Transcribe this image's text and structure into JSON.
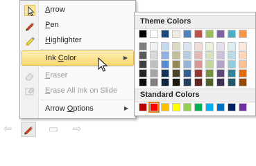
{
  "menu": {
    "items": [
      {
        "label": "Arrow",
        "hotkey": "A",
        "rest": "rrow",
        "icon": "arrow-pointer-icon",
        "checked": true,
        "disabled": false,
        "submenu": false
      },
      {
        "label": "Pen",
        "hotkey": "P",
        "rest": "en",
        "icon": "pen-icon",
        "checked": false,
        "disabled": false,
        "submenu": false
      },
      {
        "label": "Highlighter",
        "hotkey": "H",
        "rest": "ighlighter",
        "icon": "highlighter-icon",
        "checked": false,
        "disabled": false,
        "submenu": false
      },
      {
        "label": "Ink Color",
        "hotkey": "C",
        "pre": "Ink ",
        "rest": "olor",
        "icon": "",
        "checked": false,
        "disabled": false,
        "submenu": true,
        "highlighted": true
      },
      {
        "label": "Eraser",
        "hotkey": "E",
        "rest": "raser",
        "icon": "eraser-icon",
        "checked": false,
        "disabled": true,
        "submenu": false
      },
      {
        "label": "Erase All Ink on Slide",
        "hotkey": "E",
        "rest": "rase All Ink on Slide",
        "icon": "erase-all-icon",
        "checked": false,
        "disabled": true,
        "submenu": false
      },
      {
        "label": "Arrow Options",
        "hotkey": "O",
        "pre": "Arrow ",
        "rest": "ptions",
        "icon": "",
        "checked": false,
        "disabled": false,
        "submenu": true
      }
    ]
  },
  "palette": {
    "theme_title": "Theme Colors",
    "standard_title": "Standard Colors",
    "theme_top": [
      "#000000",
      "#ffffff",
      "#1f497d",
      "#eeece1",
      "#4f81bd",
      "#c0504d",
      "#9bbb59",
      "#8064a2",
      "#4bacc6",
      "#f79646"
    ],
    "theme_shades": [
      [
        "#7f7f7f",
        "#f2f2f2",
        "#c6d9f0",
        "#ddd9c3",
        "#dbe5f1",
        "#f2dcdb",
        "#ebf1dd",
        "#e5e0ec",
        "#dbeef3",
        "#fdeada"
      ],
      [
        "#595959",
        "#d8d8d8",
        "#8db3e2",
        "#c4bd97",
        "#b8cce4",
        "#e5b9b7",
        "#d7e3bc",
        "#ccc1d9",
        "#b7dde8",
        "#fbd5b5"
      ],
      [
        "#3f3f3f",
        "#bfbfbf",
        "#548dd4",
        "#938953",
        "#95b3d7",
        "#d99694",
        "#c3d69b",
        "#b2a2c7",
        "#92cddc",
        "#fac08f"
      ],
      [
        "#262626",
        "#a5a5a5",
        "#17365d",
        "#494429",
        "#366092",
        "#953734",
        "#76923c",
        "#5f497a",
        "#31859b",
        "#e36c09"
      ],
      [
        "#0c0c0c",
        "#7f7f7f",
        "#0f243e",
        "#1d1b10",
        "#244061",
        "#632423",
        "#4f6128",
        "#3f3151",
        "#205867",
        "#974806"
      ]
    ],
    "standard": [
      "#c00000",
      "#ff0000",
      "#ffc000",
      "#ffff00",
      "#92d050",
      "#00b050",
      "#00b0f0",
      "#0070c0",
      "#002060",
      "#7030a0"
    ],
    "standard_selected_index": 1
  },
  "toolbar": {
    "buttons": [
      {
        "name": "previous-arrow-icon",
        "glyph": "⇦"
      },
      {
        "name": "pen-icon",
        "glyph": ""
      },
      {
        "name": "slide-menu-icon",
        "glyph": "▭"
      },
      {
        "name": "next-arrow-icon",
        "glyph": "⇨"
      }
    ]
  }
}
